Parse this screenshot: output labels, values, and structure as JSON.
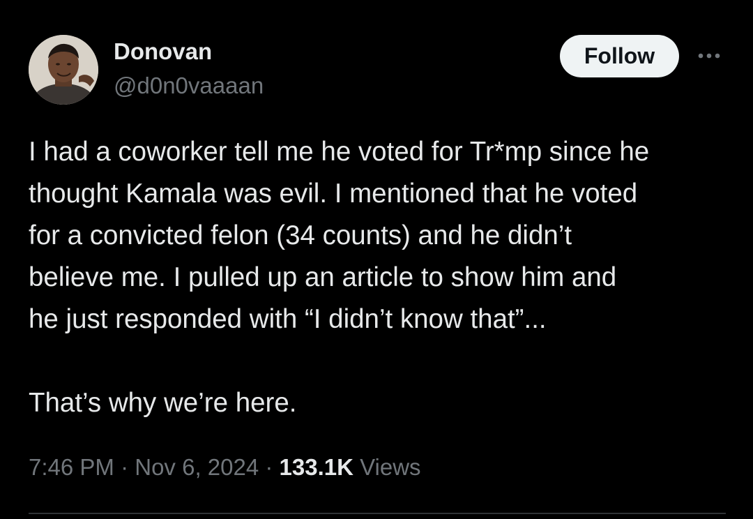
{
  "author": {
    "display_name": "Donovan",
    "handle": "@d0n0vaaaan"
  },
  "actions": {
    "follow_label": "Follow",
    "more_icon": "more-horizontal-icon"
  },
  "tweet": {
    "lines": [
      "I had a coworker tell me he voted for Tr*mp since he",
      "thought Kamala was evil. I mentioned that he voted",
      "for a convicted felon (34 counts) and he didn’t",
      "believe me. I pulled up an article to show him and",
      "he just responded with “I didn’t know that”..."
    ],
    "closing_line": "That’s why we’re here."
  },
  "meta": {
    "time": "7:46 PM",
    "separator": " · ",
    "date": "Nov 6, 2024",
    "views_count": "133.1K",
    "views_label": "Views"
  },
  "colors": {
    "background": "#000000",
    "primary_text": "#e7e9ea",
    "secondary_text": "#71767b",
    "follow_button_bg": "#eff3f4",
    "divider": "#2f3336"
  }
}
